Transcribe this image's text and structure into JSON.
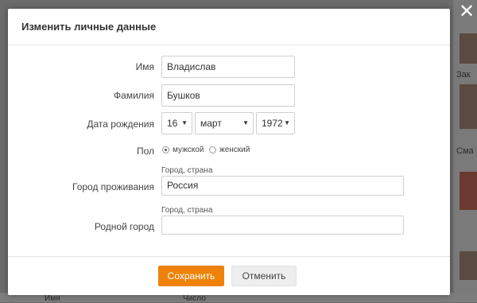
{
  "modal": {
    "title": "Изменить личные данные",
    "close_icon": "close-icon"
  },
  "form": {
    "first_name_label": "Имя",
    "first_name_value": "Владислав",
    "last_name_label": "Фамилия",
    "last_name_value": "Бушков",
    "birth_label": "Дата рождения",
    "birth_day": "16",
    "birth_month": "март",
    "birth_year": "1972",
    "gender_label": "Пол",
    "gender_options": [
      "мужской",
      "женский"
    ],
    "gender_selected": "мужской",
    "city_label": "Город проживания",
    "city_hint": "Город, страна",
    "city_value": "Россия",
    "hometown_label": "Родной город",
    "hometown_hint": "Город, страна",
    "hometown_value": ""
  },
  "buttons": {
    "save": "Сохранить",
    "cancel": "Отменить"
  },
  "background": {
    "side_texts": [
      "Зак",
      "Сма"
    ],
    "bottom_texts": [
      "Имя",
      "Число"
    ]
  },
  "colors": {
    "accent": "#ee8208",
    "overlay": "#6b6b6b"
  }
}
